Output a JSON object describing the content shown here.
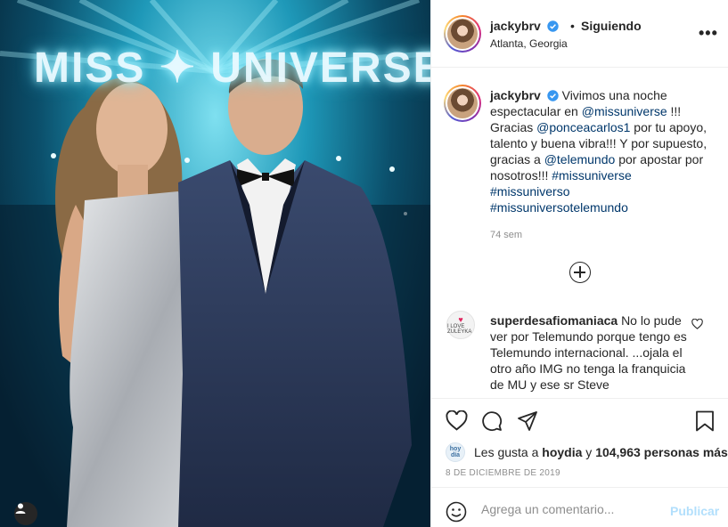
{
  "post": {
    "photo_text": "MISS ✦ UNIVERSE",
    "user_tag_icon": "user-icon"
  },
  "header": {
    "username": "jackybrv",
    "verified_icon": "verified-badge-icon",
    "separator": "•",
    "follow_status": "Siguiendo",
    "location": "Atlanta, Georgia",
    "more_icon": "more-horizontal-icon"
  },
  "caption": {
    "username": "jackybrv",
    "text_1": "Vivimos una noche espectacular en",
    "mention_1": "@missuniverse",
    "text_2": "!!! Gracias",
    "mention_2": "@ponceacarlos1",
    "text_3": "por tu apoyo, talento y buena vibra!!! Y por supuesto, gracias a",
    "mention_3": "@telemundo",
    "text_4": "por apostar por nosotros!!!",
    "hashtags": [
      "#missuniverse",
      "#missuniverso",
      "#missuniversotelemundo"
    ],
    "time_ago": "74 sem"
  },
  "comment": {
    "avatar_text": "I LOVE ZULEYKA",
    "username": "superdesafiomaniaca",
    "text": "No lo pude ver por Telemundo porque tengo es Telemundo internacional. ...ojala el otro año IMG no tenga la franquicia de MU y ese sr Steve"
  },
  "likes": {
    "liker_avatar_text": "hoy día",
    "prefix": "Les gusta a",
    "liker": "hoydia",
    "middle": "y",
    "count": "104,963 personas más"
  },
  "date": "8 DE DICIEMBRE DE 2019",
  "comment_box": {
    "placeholder": "Agrega un comentario...",
    "publish_label": "Publicar"
  },
  "colors": {
    "link": "#00376b",
    "publish_disabled": "#b2dffc",
    "verified": "#3897f0",
    "story_ring": [
      "#f58529",
      "#dd2a7b",
      "#8134af",
      "#515bd4"
    ]
  }
}
